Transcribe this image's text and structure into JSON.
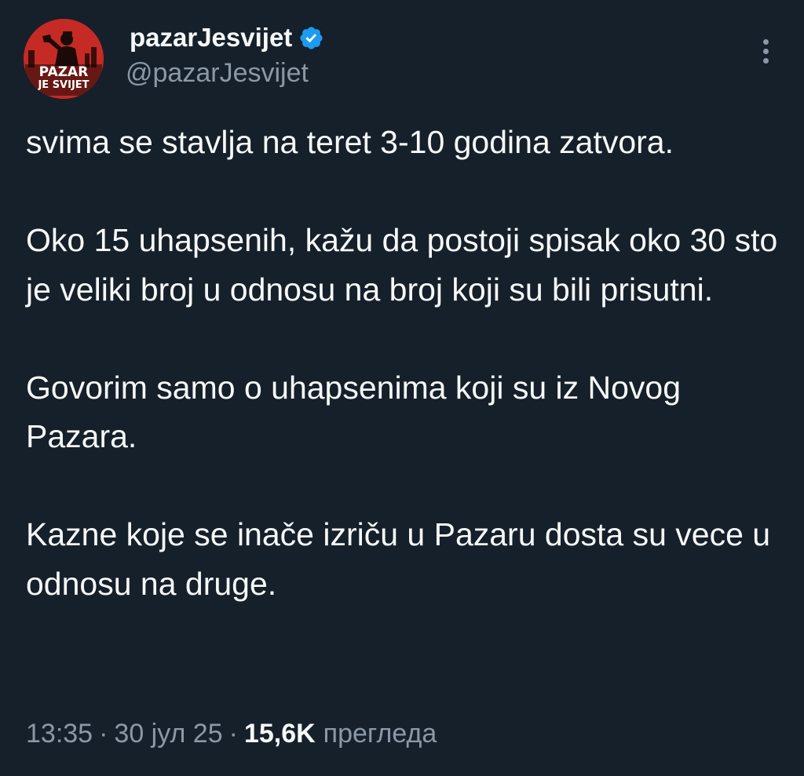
{
  "author": {
    "display_name": "pazarJesvijet",
    "handle": "@pazarJesvijet",
    "verified": true,
    "verified_icon": "verified-badge-icon",
    "avatar_text_line1": "PAZAR",
    "avatar_text_line2": "JE SVIJET",
    "avatar_color": "#c62a24"
  },
  "menu": {
    "icon": "more-vertical-icon"
  },
  "tweet": {
    "paragraphs": [
      "svima se stavlja na teret 3-10 godina zatvora.",
      "Oko 15 uhapsenih, kažu da postoji spisak oko 30 sto je veliki broj u odnosu na broj koji su bili prisutni.",
      "Govorim samo o uhapsenima koji su iz Novog Pazara.",
      "Kazne koje se inače izriču u Pazaru dosta su vece u odnosu na druge."
    ]
  },
  "meta": {
    "time": "13:35",
    "separator": "·",
    "date": "30 јул 25",
    "views_count": "15,6K",
    "views_label": "прегледа"
  },
  "colors": {
    "background": "#15202b",
    "text": "#f7f9f9",
    "secondary_text": "#8b98a5",
    "verified_blue": "#1d9bf0"
  }
}
